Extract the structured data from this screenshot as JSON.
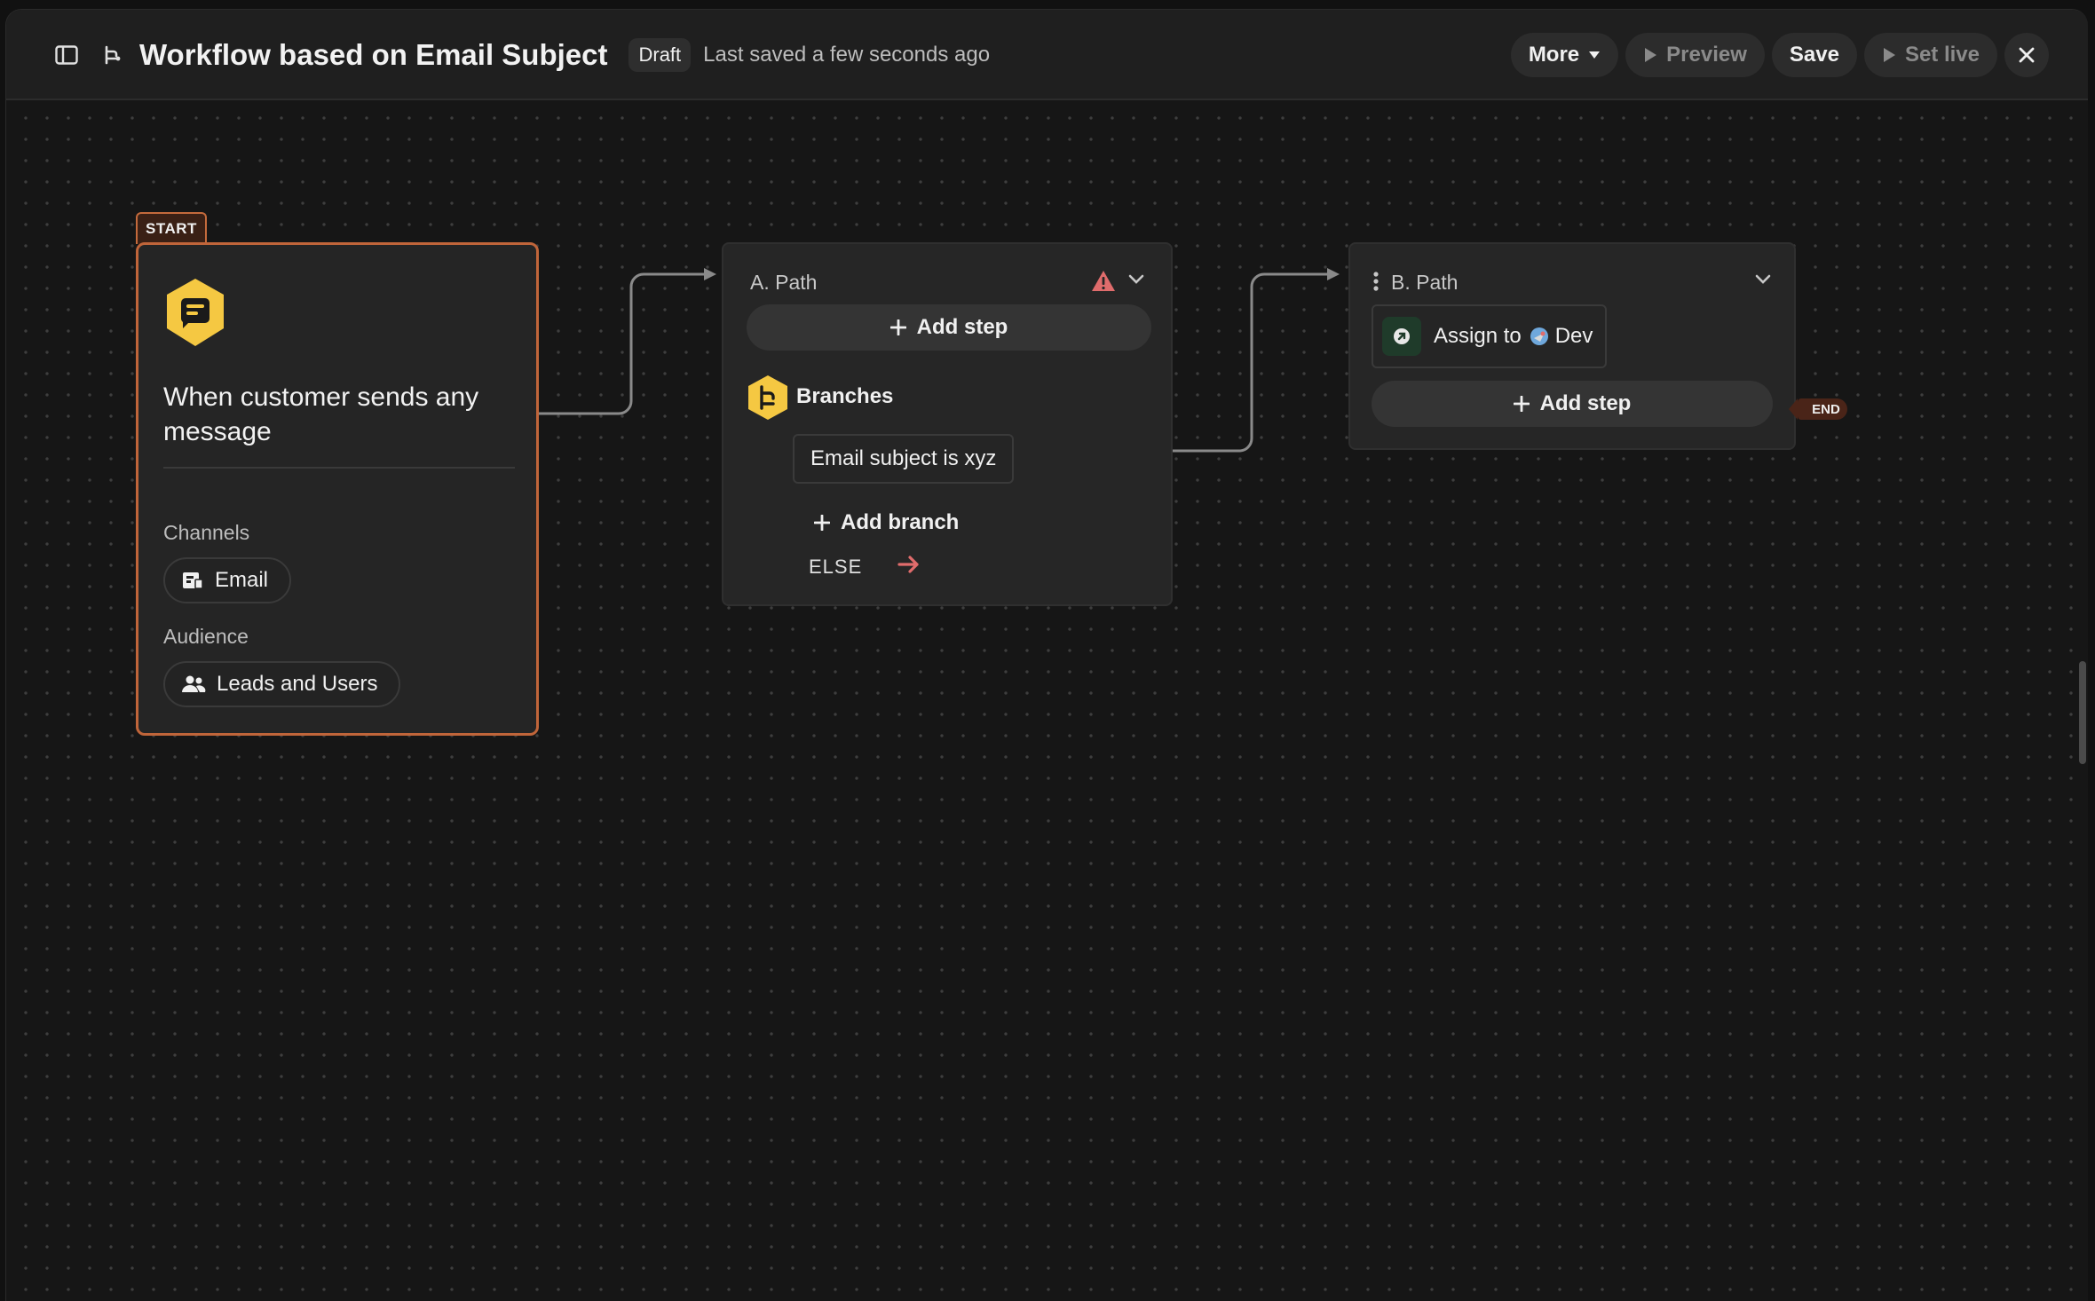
{
  "header": {
    "title": "Workflow based on Email Subject",
    "status_badge": "Draft",
    "saved_text": "Last saved a few seconds ago",
    "actions": {
      "more": "More",
      "preview": "Preview",
      "save": "Save",
      "set_live": "Set live"
    }
  },
  "start_node": {
    "tag": "START",
    "title": "When customer sends any message",
    "channels_label": "Channels",
    "channel": "Email",
    "audience_label": "Audience",
    "audience": "Leads and Users",
    "icon": "chat-bubble-icon",
    "accent_color": "#c0653a"
  },
  "path_a": {
    "title": "A. Path",
    "add_step": "Add step",
    "branches_label": "Branches",
    "branches": [
      "Email subject is xyz"
    ],
    "add_branch": "Add branch",
    "else_label": "ELSE",
    "warning_color": "#e06c6c"
  },
  "path_b": {
    "title": "B. Path",
    "step": "Assign to",
    "assignee": "Dev",
    "add_step": "Add step",
    "end_tag": "END"
  },
  "colors": {
    "brand_yellow": "#f5c842",
    "background": "#161616",
    "card": "#262626"
  }
}
